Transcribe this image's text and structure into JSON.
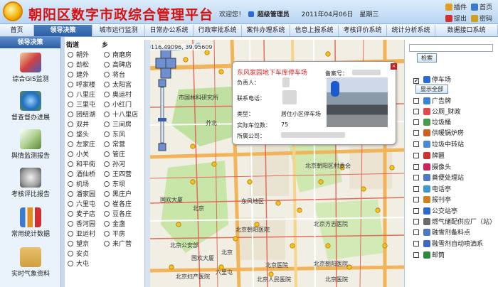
{
  "header": {
    "title": "朝阳区数字市政综合管理平台",
    "welcome": "欢迎您！",
    "user": "超级管理员",
    "date": "2011年04月06日",
    "weekday": "星期三",
    "buttons": [
      "插件",
      "首页",
      "提出",
      "密码"
    ]
  },
  "nav": {
    "tabs": [
      "首页",
      "领导决策",
      "城市运行监测",
      "日常办公系统",
      "行政审批系统",
      "案件办理系统",
      "信息上报系统",
      "考核评价系统",
      "统计分析系统",
      "数据接口系统"
    ],
    "active": 1
  },
  "sidebar": {
    "title": "领导决策",
    "items": [
      "综合GIS监测",
      "督查督办进展",
      "舆情监测报告",
      "考核评比报告",
      "常用统计数据",
      "实时气象资料"
    ]
  },
  "districts": {
    "col1_head": "街道",
    "col2_head": "乡",
    "col1": [
      "朝外",
      "劲松",
      "建外",
      "呼家楼",
      "八里庄",
      "三里屯",
      "团结湖",
      "双井",
      "垡头",
      "左家庄",
      "小关",
      "和平街",
      "酒仙桥",
      "机场",
      "潘家园",
      "六里屯",
      "麦子店",
      "香河园",
      "亚运村",
      "望京",
      "安贞",
      "大屯"
    ],
    "col2": [
      "南磨房",
      "高碑店",
      "将台",
      "太阳宫",
      "奥运村",
      "小红门",
      "十八里店",
      "三间房",
      "东风",
      "常营",
      "管庄",
      "孙河",
      "王四营",
      "东坝",
      "黑庄户",
      "崔各庄",
      "豆各庄",
      "金盏",
      "平房",
      "来广营"
    ]
  },
  "map": {
    "coords": "116.49096, 39.95609",
    "labels": [
      {
        "t": "市国林科研究所"
      },
      {
        "t": "芥北"
      },
      {
        "t": "国欢大厦"
      },
      {
        "t": "北京"
      },
      {
        "t": "国欢大厦"
      },
      {
        "t": "北京"
      },
      {
        "t": "东风地区"
      },
      {
        "t": "北京朝阳医院"
      },
      {
        "t": "北京方志医院"
      },
      {
        "t": "北京朝阳医院"
      },
      {
        "t": "北京妇产医院"
      },
      {
        "t": "北京公安部"
      },
      {
        "t": "六里屯"
      },
      {
        "t": "北京医院"
      },
      {
        "t": "北京人民医院"
      },
      {
        "t": "北京医院"
      },
      {
        "t": "北京朝阳区村委会"
      }
    ]
  },
  "popup": {
    "title": "东风家园地下车库停车场",
    "fields": [
      {
        "label": "负责人："
      },
      {
        "label": "联系电话："
      },
      {
        "label": "类型：",
        "value": "居住小区停车场"
      },
      {
        "label": "实际车位数：",
        "value": "75"
      },
      {
        "label": "所属公司："
      }
    ],
    "reg_label": "备案号："
  },
  "right": {
    "search": "检索",
    "show_all": "显示全部",
    "layers": [
      {
        "name": "停车场",
        "checked": true,
        "color": "#2a6bd6"
      },
      {
        "name": "广告牌",
        "checked": false,
        "color": "#3c82d8"
      },
      {
        "name": "公厕_财政",
        "checked": false,
        "color": "#e24a4a"
      },
      {
        "name": "垃圾桶",
        "checked": false,
        "color": "#4a9a4a"
      },
      {
        "name": "供暖锅炉房",
        "checked": false,
        "color": "#d06020"
      },
      {
        "name": "垃圾中转站",
        "checked": false,
        "color": "#4a8ad0"
      },
      {
        "name": "牌匾",
        "checked": false,
        "color": "#d03030"
      },
      {
        "name": "摄像头",
        "checked": false,
        "color": "#d02060"
      },
      {
        "name": "粪便处理站",
        "checked": false,
        "color": "#4a7ac0"
      },
      {
        "name": "电话亭",
        "checked": false,
        "color": "#3a9ad0"
      },
      {
        "name": "报刊亭",
        "checked": false,
        "color": "#d08020"
      },
      {
        "name": "公交站亭",
        "checked": false,
        "color": "#2a6ad0"
      },
      {
        "name": "燃气储配供应厂（站）",
        "checked": false,
        "color": "#6a6a6a"
      },
      {
        "name": "融雪剂备料点",
        "checked": false,
        "color": "#4a7ac0"
      },
      {
        "name": "融雪剂自动喷洒系",
        "checked": false,
        "color": "#3a6ac0"
      },
      {
        "name": "邮筒",
        "checked": false,
        "color": "#2a8a3a"
      }
    ]
  }
}
